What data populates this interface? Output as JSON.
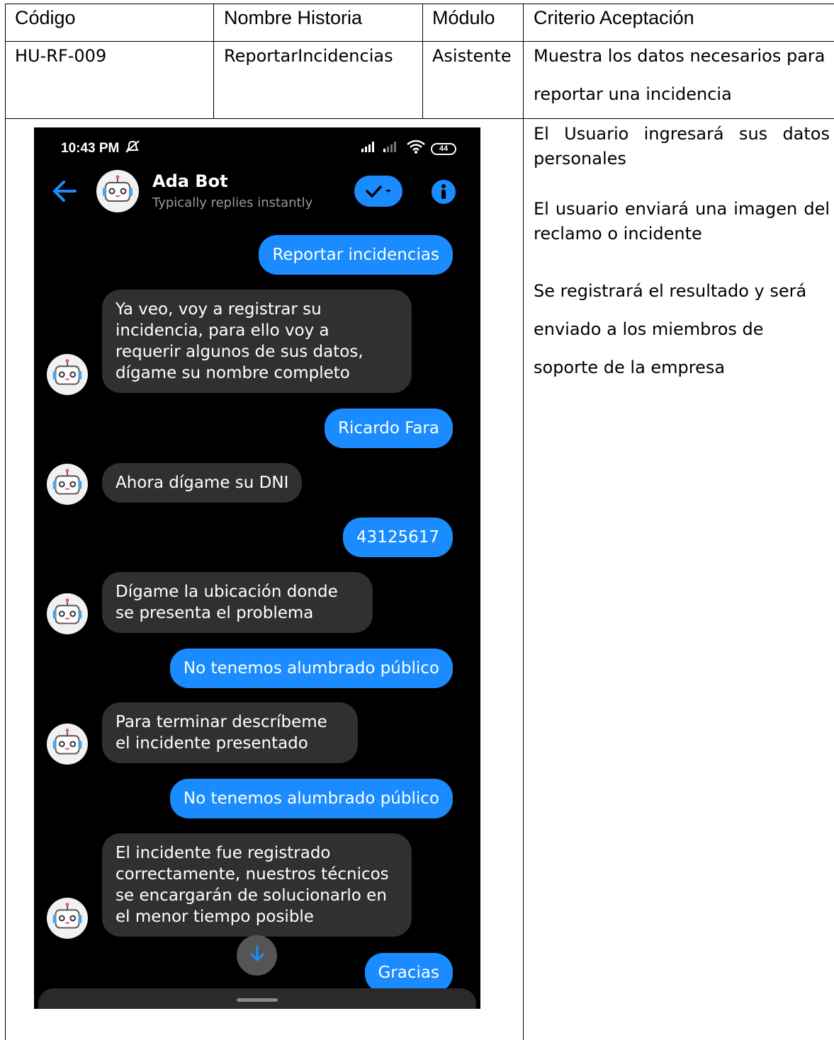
{
  "table": {
    "headers": {
      "code": "Código",
      "story_name": "Nombre Historia",
      "module": "Módulo",
      "acceptance": "Criterio Aceptación"
    },
    "row": {
      "code": "HU-RF-009",
      "story_name": "ReportarIncidencias",
      "module": "Asistente",
      "acceptance_line1": "Muestra los datos necesarios para",
      "acceptance_line2": "reportar una incidencia"
    },
    "criteria": {
      "c1_line1": "El Usuario ingresará sus datos",
      "c1_line2": "personales",
      "c2_line1": "El usuario enviará una imagen del",
      "c2_line2": "reclamo o incidente",
      "c3_line1": "Se registrará el resultado y será",
      "c3_line2": "enviado a los miembros de",
      "c3_line3": "soporte de la empresa"
    }
  },
  "phone": {
    "status_time": "10:43 PM",
    "battery": "44",
    "bot_name": "Ada Bot",
    "bot_subtitle": "Typically replies instantly",
    "messages": [
      {
        "from": "user",
        "text": "Reportar incidencias"
      },
      {
        "from": "bot",
        "text": "Ya veo, voy a registrar su incidencia, para ello voy a requerir algunos de sus datos, dígame su nombre completo"
      },
      {
        "from": "user",
        "text": "Ricardo Fara"
      },
      {
        "from": "bot",
        "text": "Ahora dígame su DNI"
      },
      {
        "from": "user",
        "text": "43125617"
      },
      {
        "from": "bot",
        "text": "Dígame la ubicación donde se presenta el problema"
      },
      {
        "from": "user",
        "text": "No tenemos alumbrado público"
      },
      {
        "from": "bot",
        "text": "Para terminar descríbeme el incidente presentado"
      },
      {
        "from": "user",
        "text": "No tenemos alumbrado público"
      },
      {
        "from": "bot",
        "text": "El incidente fue registrado correctamente, nuestros técnicos se encargarán de solucionarlo en el menor tiempo posible"
      },
      {
        "from": "user",
        "text": "Gracias"
      }
    ],
    "colors": {
      "accent": "#1a8cff",
      "incoming": "#303030",
      "background": "#000000"
    },
    "icons": [
      "back-arrow-icon",
      "bot-avatar-icon",
      "checkmark-icon",
      "info-icon",
      "scroll-down-arrow-icon",
      "wifi-icon",
      "signal-icon",
      "mute-icon"
    ]
  }
}
